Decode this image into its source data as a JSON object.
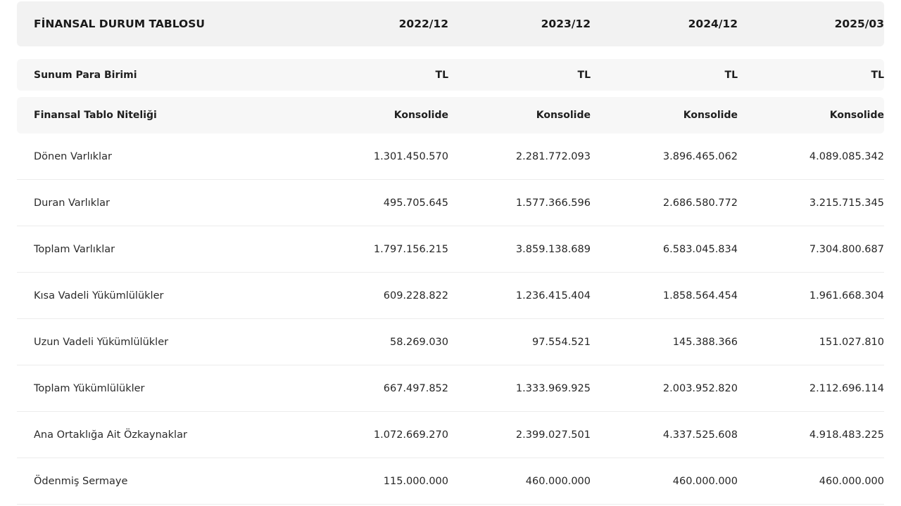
{
  "table": {
    "title": "FİNANSAL DURUM TABLOSU",
    "periods": [
      "2022/12",
      "2023/12",
      "2024/12",
      "2025/03"
    ],
    "meta_rows": [
      {
        "label": "Sunum Para Birimi",
        "values": [
          "TL",
          "TL",
          "TL",
          "TL"
        ]
      },
      {
        "label": "Finansal Tablo Niteliği",
        "values": [
          "Konsolide",
          "Konsolide",
          "Konsolide",
          "Konsolide"
        ]
      }
    ],
    "rows": [
      {
        "label": "Dönen Varlıklar",
        "values": [
          "1.301.450.570",
          "2.281.772.093",
          "3.896.465.062",
          "4.089.085.342"
        ]
      },
      {
        "label": "Duran Varlıklar",
        "values": [
          "495.705.645",
          "1.577.366.596",
          "2.686.580.772",
          "3.215.715.345"
        ]
      },
      {
        "label": "Toplam Varlıklar",
        "values": [
          "1.797.156.215",
          "3.859.138.689",
          "6.583.045.834",
          "7.304.800.687"
        ]
      },
      {
        "label": "Kısa Vadeli Yükümlülükler",
        "values": [
          "609.228.822",
          "1.236.415.404",
          "1.858.564.454",
          "1.961.668.304"
        ]
      },
      {
        "label": "Uzun Vadeli Yükümlülükler",
        "values": [
          "58.269.030",
          "97.554.521",
          "145.388.366",
          "151.027.810"
        ]
      },
      {
        "label": "Toplam Yükümlülükler",
        "values": [
          "667.497.852",
          "1.333.969.925",
          "2.003.952.820",
          "2.112.696.114"
        ]
      },
      {
        "label": "Ana Ortaklığa Ait Özkaynaklar",
        "values": [
          "1.072.669.270",
          "2.399.027.501",
          "4.337.525.608",
          "4.918.483.225"
        ]
      },
      {
        "label": "Ödenmiş Sermaye",
        "values": [
          "115.000.000",
          "460.000.000",
          "460.000.000",
          "460.000.000"
        ]
      }
    ]
  }
}
